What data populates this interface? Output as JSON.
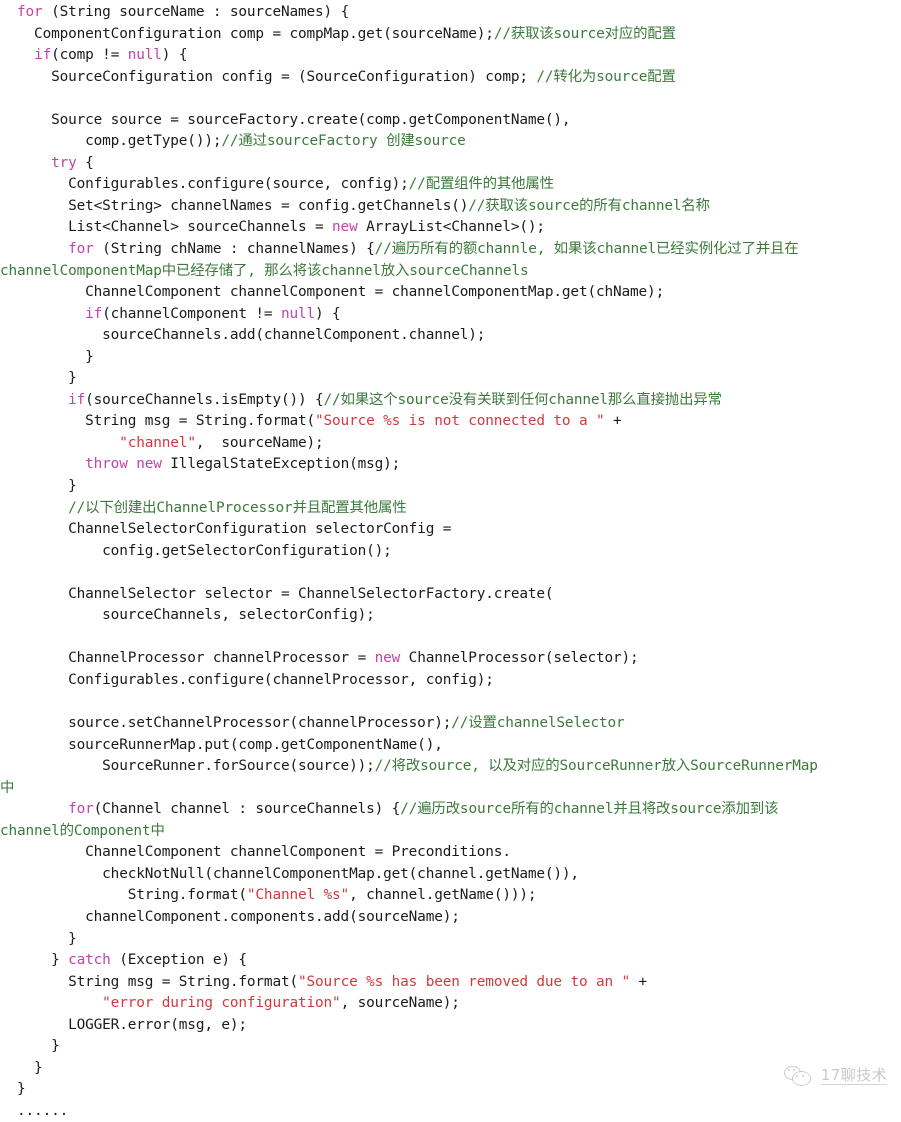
{
  "document": {
    "kind": "code-snippet",
    "language": "Java",
    "colors": {
      "background": "#ffffff",
      "plain": "#1b1b1b",
      "keyword": "#c044a8",
      "comment": "#3c7a3c",
      "string": "#d2393f",
      "watermark": "#7d7d7d"
    }
  },
  "watermark": {
    "logo": "wechat-bubbles-icon",
    "label": "17聊技术"
  },
  "code": {
    "lines": [
      [
        {
          "t": "pl",
          "v": "  "
        },
        {
          "t": "kw",
          "v": "for"
        },
        {
          "t": "pl",
          "v": " (String sourceName : sourceNames) {"
        }
      ],
      [
        {
          "t": "pl",
          "v": "    ComponentConfiguration comp = compMap.get(sourceName);"
        },
        {
          "t": "cm",
          "v": "//获取该source对应的配置"
        }
      ],
      [
        {
          "t": "pl",
          "v": "    "
        },
        {
          "t": "kw",
          "v": "if"
        },
        {
          "t": "pl",
          "v": "(comp != "
        },
        {
          "t": "kw",
          "v": "null"
        },
        {
          "t": "pl",
          "v": ") {"
        }
      ],
      [
        {
          "t": "pl",
          "v": "      SourceConfiguration config = (SourceConfiguration) comp; "
        },
        {
          "t": "cm",
          "v": "//转化为source配置"
        }
      ],
      [
        {
          "t": "pl",
          "v": ""
        }
      ],
      [
        {
          "t": "pl",
          "v": "      Source source = sourceFactory.create(comp.getComponentName(),"
        }
      ],
      [
        {
          "t": "pl",
          "v": "          comp.getType());"
        },
        {
          "t": "cm",
          "v": "//通过sourceFactory 创建source"
        }
      ],
      [
        {
          "t": "pl",
          "v": "      "
        },
        {
          "t": "kw",
          "v": "try"
        },
        {
          "t": "pl",
          "v": " {"
        }
      ],
      [
        {
          "t": "pl",
          "v": "        Configurables.configure(source, config);"
        },
        {
          "t": "cm",
          "v": "//配置组件的其他属性"
        }
      ],
      [
        {
          "t": "pl",
          "v": "        Set<String> channelNames = config.getChannels()"
        },
        {
          "t": "cm",
          "v": "//获取该source的所有channel名称"
        }
      ],
      [
        {
          "t": "pl",
          "v": "        List<Channel> sourceChannels = "
        },
        {
          "t": "kw",
          "v": "new"
        },
        {
          "t": "pl",
          "v": " ArrayList<Channel>();"
        }
      ],
      [
        {
          "t": "pl",
          "v": "        "
        },
        {
          "t": "kw",
          "v": "for"
        },
        {
          "t": "pl",
          "v": " (String chName : channelNames) {"
        },
        {
          "t": "cm",
          "v": "//遍历所有的额channle, 如果该channel已经实例化过了并且在"
        }
      ],
      [
        {
          "t": "cm",
          "v": "channelComponentMap中已经存储了, 那么将该channel放入sourceChannels"
        }
      ],
      [
        {
          "t": "pl",
          "v": "          ChannelComponent channelComponent = channelComponentMap.get(chName);"
        }
      ],
      [
        {
          "t": "pl",
          "v": "          "
        },
        {
          "t": "kw",
          "v": "if"
        },
        {
          "t": "pl",
          "v": "(channelComponent != "
        },
        {
          "t": "kw",
          "v": "null"
        },
        {
          "t": "pl",
          "v": ") {"
        }
      ],
      [
        {
          "t": "pl",
          "v": "            sourceChannels.add(channelComponent.channel);"
        }
      ],
      [
        {
          "t": "pl",
          "v": "          }"
        }
      ],
      [
        {
          "t": "pl",
          "v": "        }"
        }
      ],
      [
        {
          "t": "pl",
          "v": "        "
        },
        {
          "t": "kw",
          "v": "if"
        },
        {
          "t": "pl",
          "v": "(sourceChannels.isEmpty()) {"
        },
        {
          "t": "cm",
          "v": "//如果这个source没有关联到任何channel那么直接抛出异常"
        }
      ],
      [
        {
          "t": "pl",
          "v": "          String msg = String.format("
        },
        {
          "t": "str",
          "v": "\"Source %s is not connected to a \""
        },
        {
          "t": "pl",
          "v": " +"
        }
      ],
      [
        {
          "t": "pl",
          "v": "              "
        },
        {
          "t": "str",
          "v": "\"channel\""
        },
        {
          "t": "pl",
          "v": ",  sourceName);"
        }
      ],
      [
        {
          "t": "pl",
          "v": "          "
        },
        {
          "t": "kw",
          "v": "throw"
        },
        {
          "t": "pl",
          "v": " "
        },
        {
          "t": "kw",
          "v": "new"
        },
        {
          "t": "pl",
          "v": " IllegalStateException(msg);"
        }
      ],
      [
        {
          "t": "pl",
          "v": "        }"
        }
      ],
      [
        {
          "t": "cm",
          "v": "        //以下创建出ChannelProcessor并且配置其他属性"
        }
      ],
      [
        {
          "t": "pl",
          "v": "        ChannelSelectorConfiguration selectorConfig ="
        }
      ],
      [
        {
          "t": "pl",
          "v": "            config.getSelectorConfiguration();"
        }
      ],
      [
        {
          "t": "pl",
          "v": ""
        }
      ],
      [
        {
          "t": "pl",
          "v": "        ChannelSelector selector = ChannelSelectorFactory.create("
        }
      ],
      [
        {
          "t": "pl",
          "v": "            sourceChannels, selectorConfig);"
        }
      ],
      [
        {
          "t": "pl",
          "v": ""
        }
      ],
      [
        {
          "t": "pl",
          "v": "        ChannelProcessor channelProcessor = "
        },
        {
          "t": "kw",
          "v": "new"
        },
        {
          "t": "pl",
          "v": " ChannelProcessor(selector);"
        }
      ],
      [
        {
          "t": "pl",
          "v": "        Configurables.configure(channelProcessor, config);"
        }
      ],
      [
        {
          "t": "pl",
          "v": ""
        }
      ],
      [
        {
          "t": "pl",
          "v": "        source.setChannelProcessor(channelProcessor);"
        },
        {
          "t": "cm",
          "v": "//设置channelSelector"
        }
      ],
      [
        {
          "t": "pl",
          "v": "        sourceRunnerMap.put(comp.getComponentName(),"
        }
      ],
      [
        {
          "t": "pl",
          "v": "            SourceRunner.forSource(source));"
        },
        {
          "t": "cm",
          "v": "//将改source, 以及对应的SourceRunner放入SourceRunnerMap"
        }
      ],
      [
        {
          "t": "cm",
          "v": "中"
        }
      ],
      [
        {
          "t": "pl",
          "v": "        "
        },
        {
          "t": "kw",
          "v": "for"
        },
        {
          "t": "pl",
          "v": "(Channel channel : sourceChannels) {"
        },
        {
          "t": "cm",
          "v": "//遍历改source所有的channel并且将改source添加到该"
        }
      ],
      [
        {
          "t": "cm",
          "v": "channel的Component中"
        }
      ],
      [
        {
          "t": "pl",
          "v": "          ChannelComponent channelComponent = Preconditions."
        }
      ],
      [
        {
          "t": "pl",
          "v": "            checkNotNull(channelComponentMap.get(channel.getName()),"
        }
      ],
      [
        {
          "t": "pl",
          "v": "               String.format("
        },
        {
          "t": "str",
          "v": "\"Channel %s\""
        },
        {
          "t": "pl",
          "v": ", channel.getName()));"
        }
      ],
      [
        {
          "t": "pl",
          "v": "          channelComponent.components.add(sourceName);"
        }
      ],
      [
        {
          "t": "pl",
          "v": "        }"
        }
      ],
      [
        {
          "t": "pl",
          "v": "      } "
        },
        {
          "t": "kw",
          "v": "catch"
        },
        {
          "t": "pl",
          "v": " (Exception e) {"
        }
      ],
      [
        {
          "t": "pl",
          "v": "        String msg = String.format("
        },
        {
          "t": "str",
          "v": "\"Source %s has been removed due to an \""
        },
        {
          "t": "pl",
          "v": " +"
        }
      ],
      [
        {
          "t": "pl",
          "v": "            "
        },
        {
          "t": "str",
          "v": "\"error during configuration\""
        },
        {
          "t": "pl",
          "v": ", sourceName);"
        }
      ],
      [
        {
          "t": "pl",
          "v": "        LOGGER.error(msg, e);"
        }
      ],
      [
        {
          "t": "pl",
          "v": "      }"
        }
      ],
      [
        {
          "t": "pl",
          "v": "    }"
        }
      ],
      [
        {
          "t": "pl",
          "v": "  }"
        }
      ],
      [
        {
          "t": "pl",
          "v": "  ......"
        }
      ]
    ]
  }
}
